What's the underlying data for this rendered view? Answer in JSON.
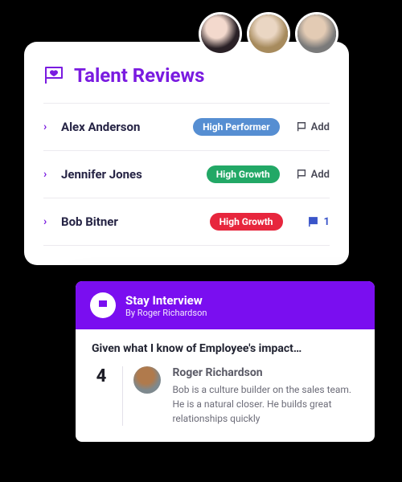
{
  "header": {
    "title": "Talent Reviews"
  },
  "rows": [
    {
      "name": "Alex Anderson",
      "badge": "High Performer",
      "badge_color": "blue",
      "action": "Add"
    },
    {
      "name": "Jennifer Jones",
      "badge": "High Growth",
      "badge_color": "green",
      "action": "Add"
    },
    {
      "name": "Bob Bitner",
      "badge": "High Growth",
      "badge_color": "red",
      "flag_count": "1"
    }
  ],
  "popup": {
    "title": "Stay Interview",
    "byline": "By Roger Richardson",
    "question": "Given what I know of Employee's impact…",
    "score": "4",
    "commenter_name": "Roger Richardson",
    "comment": "Bob is a culture builder on the sales team. He is a natural closer. He builds great relationships quickly"
  }
}
